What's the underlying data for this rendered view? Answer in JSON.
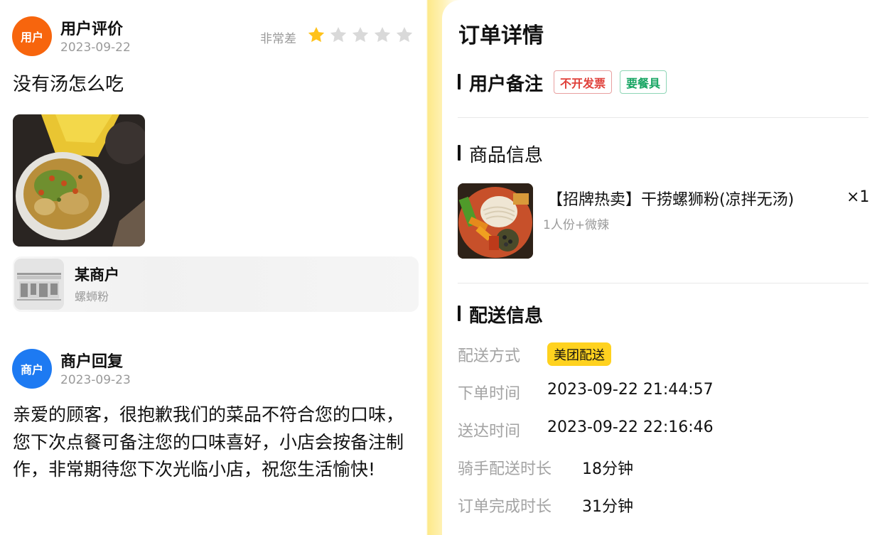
{
  "review": {
    "avatar_label": "用户",
    "name": "用户评价",
    "date": "2023-09-22",
    "rating_label": "非常差",
    "rating": 1,
    "rating_max": 5,
    "text": "没有汤怎么吃",
    "photo_icon": "food-photo"
  },
  "shop": {
    "icon": "storefront-icon",
    "name": "某商户",
    "category": "螺蛳粉"
  },
  "reply": {
    "avatar_label": "商户",
    "name": "商户回复",
    "date": "2023-09-23",
    "text": "亲爱的顾客，很抱歉我们的菜品不符合您的口味，您下次点餐可备注您的口味喜好，小店会按备注制作，非常期待您下次光临小店，祝您生活愉快!"
  },
  "order": {
    "title": "订单详情",
    "remarks": {
      "title": "用户备注",
      "tags": [
        "不开发票",
        "要餐具"
      ]
    },
    "goods": {
      "title": "商品信息",
      "item_name": "【招牌热卖】干捞螺狮粉(凉拌无汤)",
      "qty": "×1",
      "spec": "1人份+微辣"
    },
    "delivery": {
      "title": "配送信息",
      "method_label": "配送方式",
      "method_value": "美团配送",
      "order_time_label": "下单时间",
      "order_time_value": "2023-09-22 21:44:57",
      "arrive_time_label": "送达时间",
      "arrive_time_value": "2023-09-22 22:16:46",
      "rider_duration_label": "骑手配送时长",
      "rider_duration_value": "18分钟",
      "complete_duration_label": "订单完成时长",
      "complete_duration_value": "31分钟"
    }
  },
  "colors": {
    "user_avatar": "#f7650d",
    "merchant_avatar": "#1d7af2",
    "star_on": "#ffc21a",
    "star_off": "#d9d9d9",
    "tag_red": "#e0403a",
    "tag_green": "#17a563",
    "badge_yellow": "#ffd21f"
  }
}
